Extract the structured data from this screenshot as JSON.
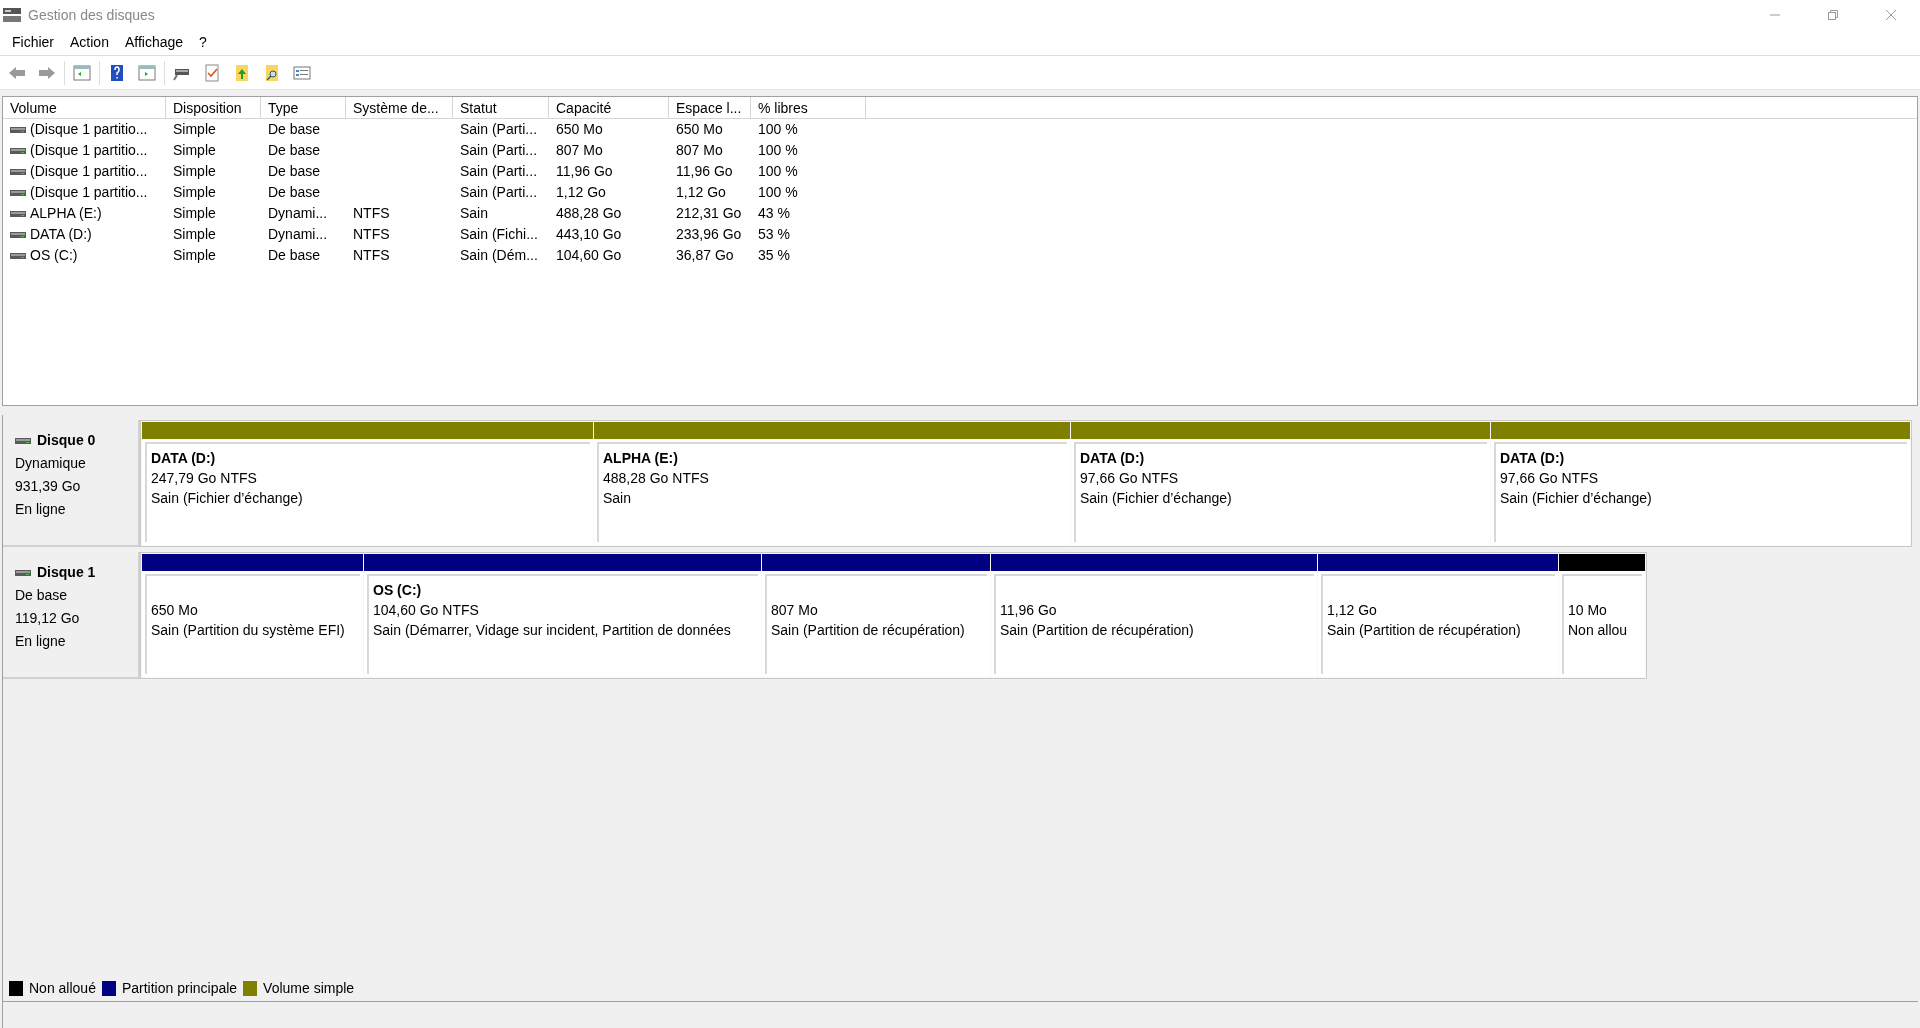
{
  "window": {
    "title": "Gestion des disques"
  },
  "menu": [
    "Fichier",
    "Action",
    "Affichage",
    "?"
  ],
  "table": {
    "columns": [
      "Volume",
      "Disposition",
      "Type",
      "Système de...",
      "Statut",
      "Capacité",
      "Espace l...",
      "% libres"
    ],
    "rows": [
      [
        "(Disque 1 partitio...",
        "Simple",
        "De base",
        "",
        "Sain (Parti...",
        "650 Mo",
        "650 Mo",
        "100 %"
      ],
      [
        "(Disque 1 partitio...",
        "Simple",
        "De base",
        "",
        "Sain (Parti...",
        "807 Mo",
        "807 Mo",
        "100 %"
      ],
      [
        "(Disque 1 partitio...",
        "Simple",
        "De base",
        "",
        "Sain (Parti...",
        "11,96 Go",
        "11,96 Go",
        "100 %"
      ],
      [
        "(Disque 1 partitio...",
        "Simple",
        "De base",
        "",
        "Sain (Parti...",
        "1,12 Go",
        "1,12 Go",
        "100 %"
      ],
      [
        "ALPHA (E:)",
        "Simple",
        "Dynami...",
        "NTFS",
        "Sain",
        "488,28 Go",
        "212,31 Go",
        "43 %"
      ],
      [
        "DATA (D:)",
        "Simple",
        "Dynami...",
        "NTFS",
        "Sain (Fichi...",
        "443,10 Go",
        "233,96 Go",
        "53 %"
      ],
      [
        "OS (C:)",
        "Simple",
        "De base",
        "NTFS",
        "Sain (Dém...",
        "104,60 Go",
        "36,87 Go",
        "35 %"
      ]
    ]
  },
  "disks": [
    {
      "name": "Disque 0",
      "type": "Dynamique",
      "size": "931,39 Go",
      "status": "En ligne",
      "partitions": [
        {
          "kind": "simple",
          "label": "DATA  (D:)",
          "size": "247,79 Go NTFS",
          "status": "Sain (Fichier d’échange)"
        },
        {
          "kind": "simple",
          "label": "ALPHA  (E:)",
          "size": "488,28 Go NTFS",
          "status": "Sain"
        },
        {
          "kind": "simple",
          "label": "DATA  (D:)",
          "size": "97,66 Go NTFS",
          "status": "Sain (Fichier d’échange)"
        },
        {
          "kind": "simple",
          "label": "DATA  (D:)",
          "size": "97,66 Go NTFS",
          "status": "Sain (Fichier d’échange)"
        }
      ]
    },
    {
      "name": "Disque 1",
      "type": "De base",
      "size": "119,12 Go",
      "status": "En ligne",
      "partitions": [
        {
          "kind": "primary",
          "size": "650 Mo",
          "status": "Sain (Partition du système EFI)"
        },
        {
          "kind": "primary",
          "label": "OS  (C:)",
          "size": "104,60 Go NTFS",
          "status": "Sain (Démarrer, Vidage sur incident, Partition de données"
        },
        {
          "kind": "primary",
          "size": "807 Mo",
          "status": "Sain (Partition de récupération)"
        },
        {
          "kind": "primary",
          "size": "11,96 Go",
          "status": "Sain (Partition de récupération)"
        },
        {
          "kind": "primary",
          "size": "1,12 Go",
          "status": "Sain (Partition de récupération)"
        },
        {
          "kind": "unallocated",
          "size": "10 Mo",
          "status": "Non allou"
        }
      ]
    }
  ],
  "legend": [
    {
      "kind": "unallocated",
      "label": "Non alloué",
      "color": "#000000"
    },
    {
      "kind": "primary",
      "label": "Partition principale",
      "color": "#000080"
    },
    {
      "kind": "simple",
      "label": "Volume simple",
      "color": "#808000"
    }
  ]
}
